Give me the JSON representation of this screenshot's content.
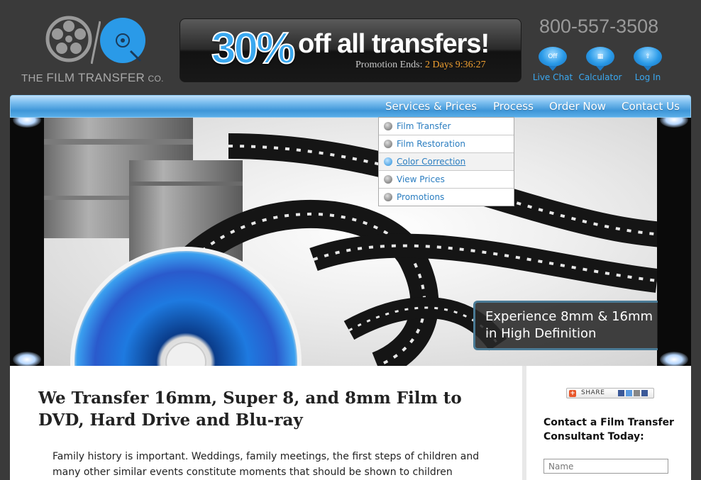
{
  "brand": {
    "logo_text_prefix": "THE",
    "logo_text_main": "FILM TRANSFER",
    "logo_text_suffix": "CO."
  },
  "promo": {
    "percent": "30%",
    "title": "off all transfers!",
    "ends_label": "Promotion Ends:",
    "countdown": "2 Days 9:36:27"
  },
  "header": {
    "phone": "800-557-3508",
    "tools": [
      {
        "label": "Live Chat",
        "icon": "chat-bubble-icon",
        "badge": "Off"
      },
      {
        "label": "Calculator",
        "icon": "calculator-bubble-icon"
      },
      {
        "label": "Log In",
        "icon": "login-bubble-icon"
      }
    ]
  },
  "nav": {
    "items": [
      "Services & Prices",
      "Process",
      "Order Now",
      "Contact Us"
    ]
  },
  "dropdown": {
    "items": [
      "Film Transfer",
      "Film Restoration",
      "Color Correction",
      "View Prices",
      "Promotions"
    ],
    "active_index": 2
  },
  "hero": {
    "caption_line1": "Experience 8mm & 16mm",
    "caption_line2": "in High Definition"
  },
  "content": {
    "title": "We Transfer 16mm, Super 8, and 8mm Film to DVD, Hard Drive and Blu-ray",
    "paragraph": "Family history is important. Weddings, family meetings, the first steps of children and many other similar events constitute moments that should be shown to children"
  },
  "sidebar": {
    "share_label": "SHARE",
    "contact_title": "Contact a Film Transfer Consultant Today:",
    "name_placeholder": "Name"
  },
  "colors": {
    "accent_blue": "#3aa8f0",
    "countdown_orange": "#f0a030",
    "background": "#3a3a3a"
  }
}
